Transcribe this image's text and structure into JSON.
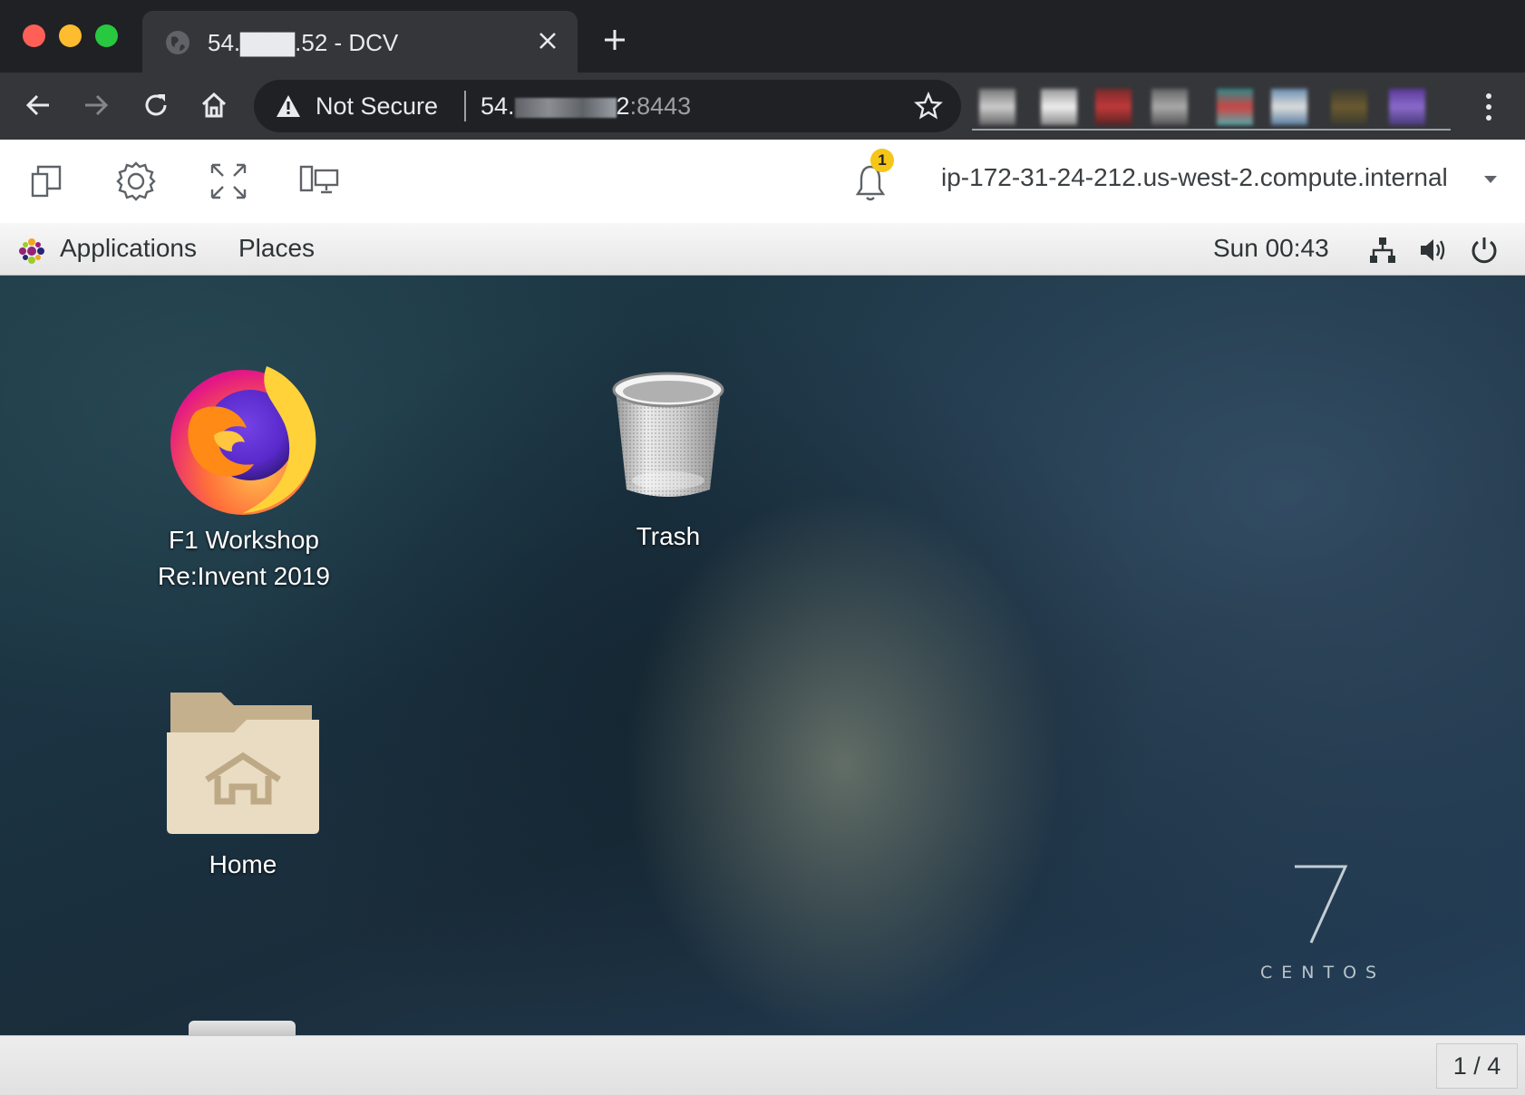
{
  "browser": {
    "tab_title": "54.▇▇▇.52 - DCV",
    "security_label": "Not Secure",
    "url_prefix": "54.",
    "url_mid": "2",
    "url_port": ":8443",
    "traffic_colors": {
      "close": "#ff5f57",
      "minimize": "#febc2e",
      "zoom": "#28c840"
    },
    "icons": [
      "globe-icon",
      "close-icon",
      "plus-icon",
      "back-arrow-icon",
      "forward-arrow-icon",
      "reload-icon",
      "home-icon",
      "warning-icon",
      "star-icon",
      "more-vert-icon"
    ]
  },
  "dcv": {
    "notification_count": "1",
    "hostname": "ip-172-31-24-212.us-west-2.compute.internal",
    "icons": [
      "copy-icon",
      "gear-icon",
      "fullscreen-icon",
      "displays-icon",
      "bell-icon",
      "caret-down-icon"
    ]
  },
  "gnome": {
    "applications": "Applications",
    "places": "Places",
    "clock": "Sun 00:43",
    "icons": [
      "network-icon",
      "volume-icon",
      "power-icon"
    ]
  },
  "desktop": {
    "firefox_label_line1": "F1 Workshop",
    "firefox_label_line2": "Re:Invent 2019",
    "trash_label": "Trash",
    "home_label": "Home",
    "centos_version": "7",
    "centos_brand": "CENTOS"
  },
  "bottom": {
    "workspace": "1 / 4"
  }
}
